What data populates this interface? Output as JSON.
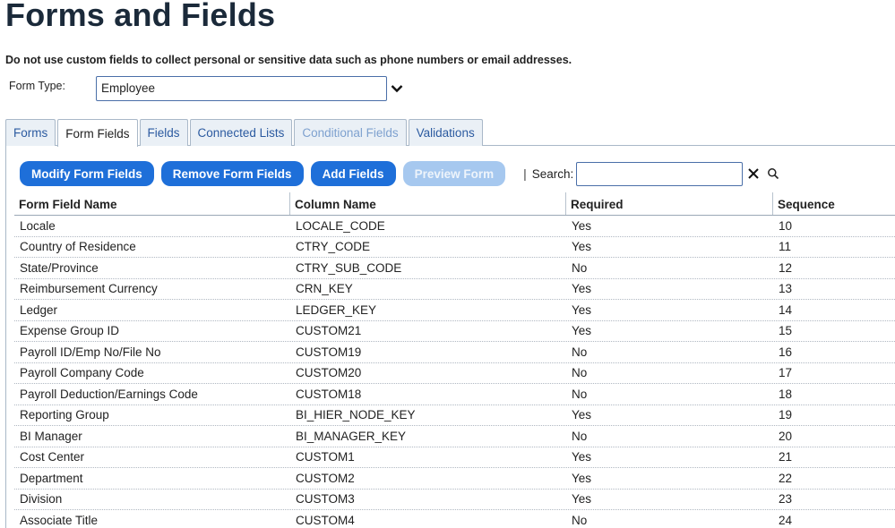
{
  "page": {
    "title": "Forms and Fields",
    "notice": "Do not use custom fields to collect personal or sensitive data such as phone numbers or email addresses."
  },
  "form_type": {
    "label": "Form Type:",
    "selected": "Employee",
    "caret_icon": "chevron-down-icon"
  },
  "tabs": [
    {
      "label": "Forms",
      "state": "normal"
    },
    {
      "label": "Form Fields",
      "state": "active"
    },
    {
      "label": "Fields",
      "state": "normal"
    },
    {
      "label": "Connected Lists",
      "state": "normal"
    },
    {
      "label": "Conditional Fields",
      "state": "disabled"
    },
    {
      "label": "Validations",
      "state": "normal"
    }
  ],
  "toolbar": {
    "buttons": [
      {
        "label": "Modify Form Fields",
        "enabled": true
      },
      {
        "label": "Remove Form Fields",
        "enabled": true
      },
      {
        "label": "Add Fields",
        "enabled": true
      },
      {
        "label": "Preview Form",
        "enabled": false
      }
    ],
    "separator": "|",
    "search_label": "Search:",
    "search_value": "",
    "clear_icon": "close-icon",
    "search_icon": "search-icon"
  },
  "grid": {
    "columns": [
      "Form Field Name",
      "Column Name",
      "Required",
      "Sequence"
    ],
    "rows": [
      [
        "Locale",
        "LOCALE_CODE",
        "Yes",
        "10"
      ],
      [
        "Country of Residence",
        "CTRY_CODE",
        "Yes",
        "11"
      ],
      [
        "State/Province",
        "CTRY_SUB_CODE",
        "No",
        "12"
      ],
      [
        "Reimbursement Currency",
        "CRN_KEY",
        "Yes",
        "13"
      ],
      [
        "Ledger",
        "LEDGER_KEY",
        "Yes",
        "14"
      ],
      [
        "Expense Group ID",
        "CUSTOM21",
        "Yes",
        "15"
      ],
      [
        "Payroll ID/Emp No/File No",
        "CUSTOM19",
        "No",
        "16"
      ],
      [
        "Payroll Company Code",
        "CUSTOM20",
        "No",
        "17"
      ],
      [
        "Payroll Deduction/Earnings Code",
        "CUSTOM18",
        "No",
        "18"
      ],
      [
        "Reporting Group",
        "BI_HIER_NODE_KEY",
        "Yes",
        "19"
      ],
      [
        "BI Manager",
        "BI_MANAGER_KEY",
        "No",
        "20"
      ],
      [
        "Cost Center",
        "CUSTOM1",
        "Yes",
        "21"
      ],
      [
        "Department",
        "CUSTOM2",
        "Yes",
        "22"
      ],
      [
        "Division",
        "CUSTOM3",
        "Yes",
        "23"
      ],
      [
        "Associate Title",
        "CUSTOM4",
        "No",
        "24"
      ]
    ]
  },
  "colors": {
    "primary_button": "#1e6fd9",
    "disabled_button": "#a6c8ef",
    "tab_text": "#2b5aa0",
    "title_text": "#1b2a3a"
  }
}
